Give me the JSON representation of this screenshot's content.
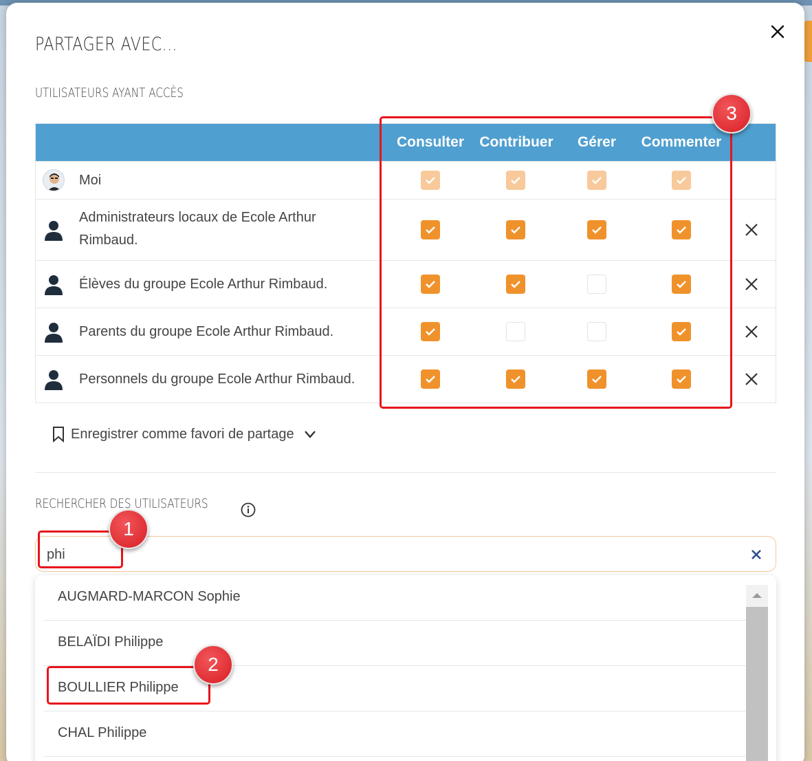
{
  "dialog": {
    "title": "PARTAGER AVEC...",
    "close_icon": "close-icon"
  },
  "access": {
    "section_label": "UTILISATEURS AYANT ACCÈS",
    "columns": [
      "Consulter",
      "Contribuer",
      "Gérer",
      "Commenter"
    ],
    "rows": [
      {
        "name": "Moi",
        "icon": "avatar",
        "permissions": [
          "disabled-checked",
          "disabled-checked",
          "disabled-checked",
          "disabled-checked"
        ],
        "removable": false
      },
      {
        "name": "Administrateurs locaux de Ecole Arthur Rimbaud.",
        "name_line1": "Administrateurs locaux de Ecole Arthur",
        "name_line2": "Rimbaud.",
        "icon": "user-icon",
        "permissions": [
          "checked",
          "checked",
          "checked",
          "checked"
        ],
        "removable": true
      },
      {
        "name": "Élèves du groupe Ecole Arthur Rimbaud.",
        "icon": "user-icon",
        "permissions": [
          "checked",
          "checked",
          "unchecked",
          "checked"
        ],
        "removable": true
      },
      {
        "name": "Parents du groupe Ecole Arthur Rimbaud.",
        "icon": "user-icon",
        "permissions": [
          "checked",
          "unchecked",
          "unchecked",
          "checked"
        ],
        "removable": true
      },
      {
        "name": "Personnels du groupe Ecole Arthur Rimbaud.",
        "icon": "user-icon",
        "permissions": [
          "checked",
          "checked",
          "checked",
          "checked"
        ],
        "removable": true
      }
    ]
  },
  "favorite": {
    "label": "Enregistrer comme favori de partage",
    "icon": "bookmark-icon",
    "chevron": "chevron-down-icon"
  },
  "search": {
    "section_label": "RECHERCHER DES UTILISATEURS",
    "info_icon": "info-icon",
    "value": "phi",
    "clear_icon": "clear-icon",
    "results": [
      "AUGMARD-MARCON Sophie",
      "BELAÏDI Philippe",
      "BOULLIER Philippe",
      "CHAL Philippe"
    ]
  },
  "annotations": {
    "badges": [
      "1",
      "2",
      "3"
    ]
  },
  "colors": {
    "header_blue": "#4f9fd0",
    "checkbox_orange": "#f0922b",
    "checkbox_disabled": "#f8c99b",
    "annotation_red": "#e8141c"
  }
}
